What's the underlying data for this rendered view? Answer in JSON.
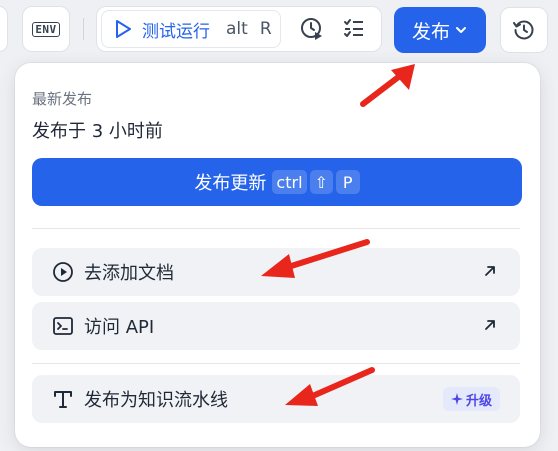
{
  "toolbar": {
    "env_label": "ENV",
    "run_label": "测试运行",
    "run_shortcut_1": "alt",
    "run_shortcut_2": "R",
    "publish_label": "发布"
  },
  "panel": {
    "latest_title": "最新发布",
    "published_time": "发布于 3 小时前",
    "update_button": {
      "label": "发布更新",
      "shortcut_1": "ctrl",
      "shortcut_2": "⇧",
      "shortcut_3": "P"
    },
    "items": [
      {
        "label": "去添加文档",
        "icon": "play-circle-icon"
      },
      {
        "label": "访问 API",
        "icon": "terminal-icon"
      }
    ],
    "pipeline": {
      "label": "发布为知识流水线",
      "badge": "升级",
      "icon": "text-t-icon"
    }
  },
  "colors": {
    "primary": "#2563eb",
    "arrow": "#e8261c",
    "badge_bg": "#e4e9fb",
    "badge_fg": "#4f46e5"
  }
}
